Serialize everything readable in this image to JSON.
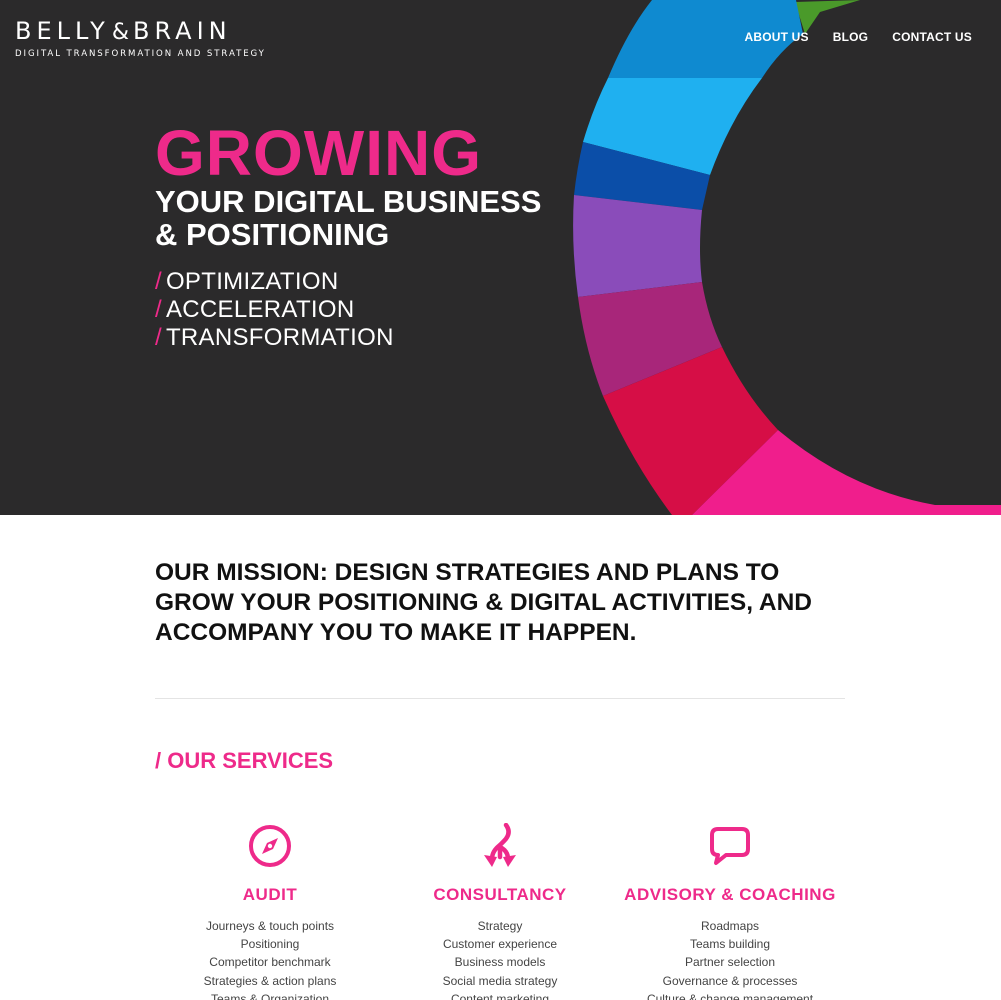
{
  "brand": {
    "name_left": "BELLY",
    "name_amp": "&",
    "name_right": "BRAIN",
    "tagline": "DIGITAL TRANSFORMATION AND STRATEGY"
  },
  "nav": {
    "items": [
      "ABOUT US",
      "BLOG",
      "CONTACT US"
    ]
  },
  "hero": {
    "headline": "GROWING",
    "subline_1": "YOUR DIGITAL BUSINESS",
    "subline_2": "& POSITIONING",
    "slash": "/",
    "list": [
      "OPTIMIZATION",
      "ACCELERATION",
      "TRANSFORMATION"
    ]
  },
  "mission": {
    "text": "OUR MISSION: DESIGN STRATEGIES AND PLANS TO GROW YOUR POSITIONING & DIGITAL ACTIVITIES, AND ACCOMPANY YOU TO MAKE IT HAPPEN."
  },
  "services": {
    "title": "/ OUR SERVICES",
    "items": [
      {
        "title": "AUDIT",
        "icon": "compass-icon",
        "lines": [
          "Journeys & touch points",
          "Positioning",
          "Competitor benchmark",
          "Strategies & action plans",
          "Teams & Organization"
        ]
      },
      {
        "title": "CONSULTANCY",
        "icon": "split-arrows-icon",
        "lines": [
          "Strategy",
          "Customer experience",
          "Business models",
          "Social media strategy",
          "Content marketing"
        ]
      },
      {
        "title": "ADVISORY & COACHING",
        "icon": "speech-bubble-icon",
        "lines": [
          "Roadmaps",
          "Teams building",
          "Partner selection",
          "Governance & processes",
          "Culture & change management"
        ]
      }
    ]
  },
  "colors": {
    "accent": "#ee2a8a",
    "hero_bg": "#2b2a2b",
    "ring": [
      "#4a9a2a",
      "#0f8ad0",
      "#1fb0f0",
      "#0b4ea8",
      "#8a4cba",
      "#a8267a",
      "#d60e46",
      "#f01e8c"
    ]
  }
}
